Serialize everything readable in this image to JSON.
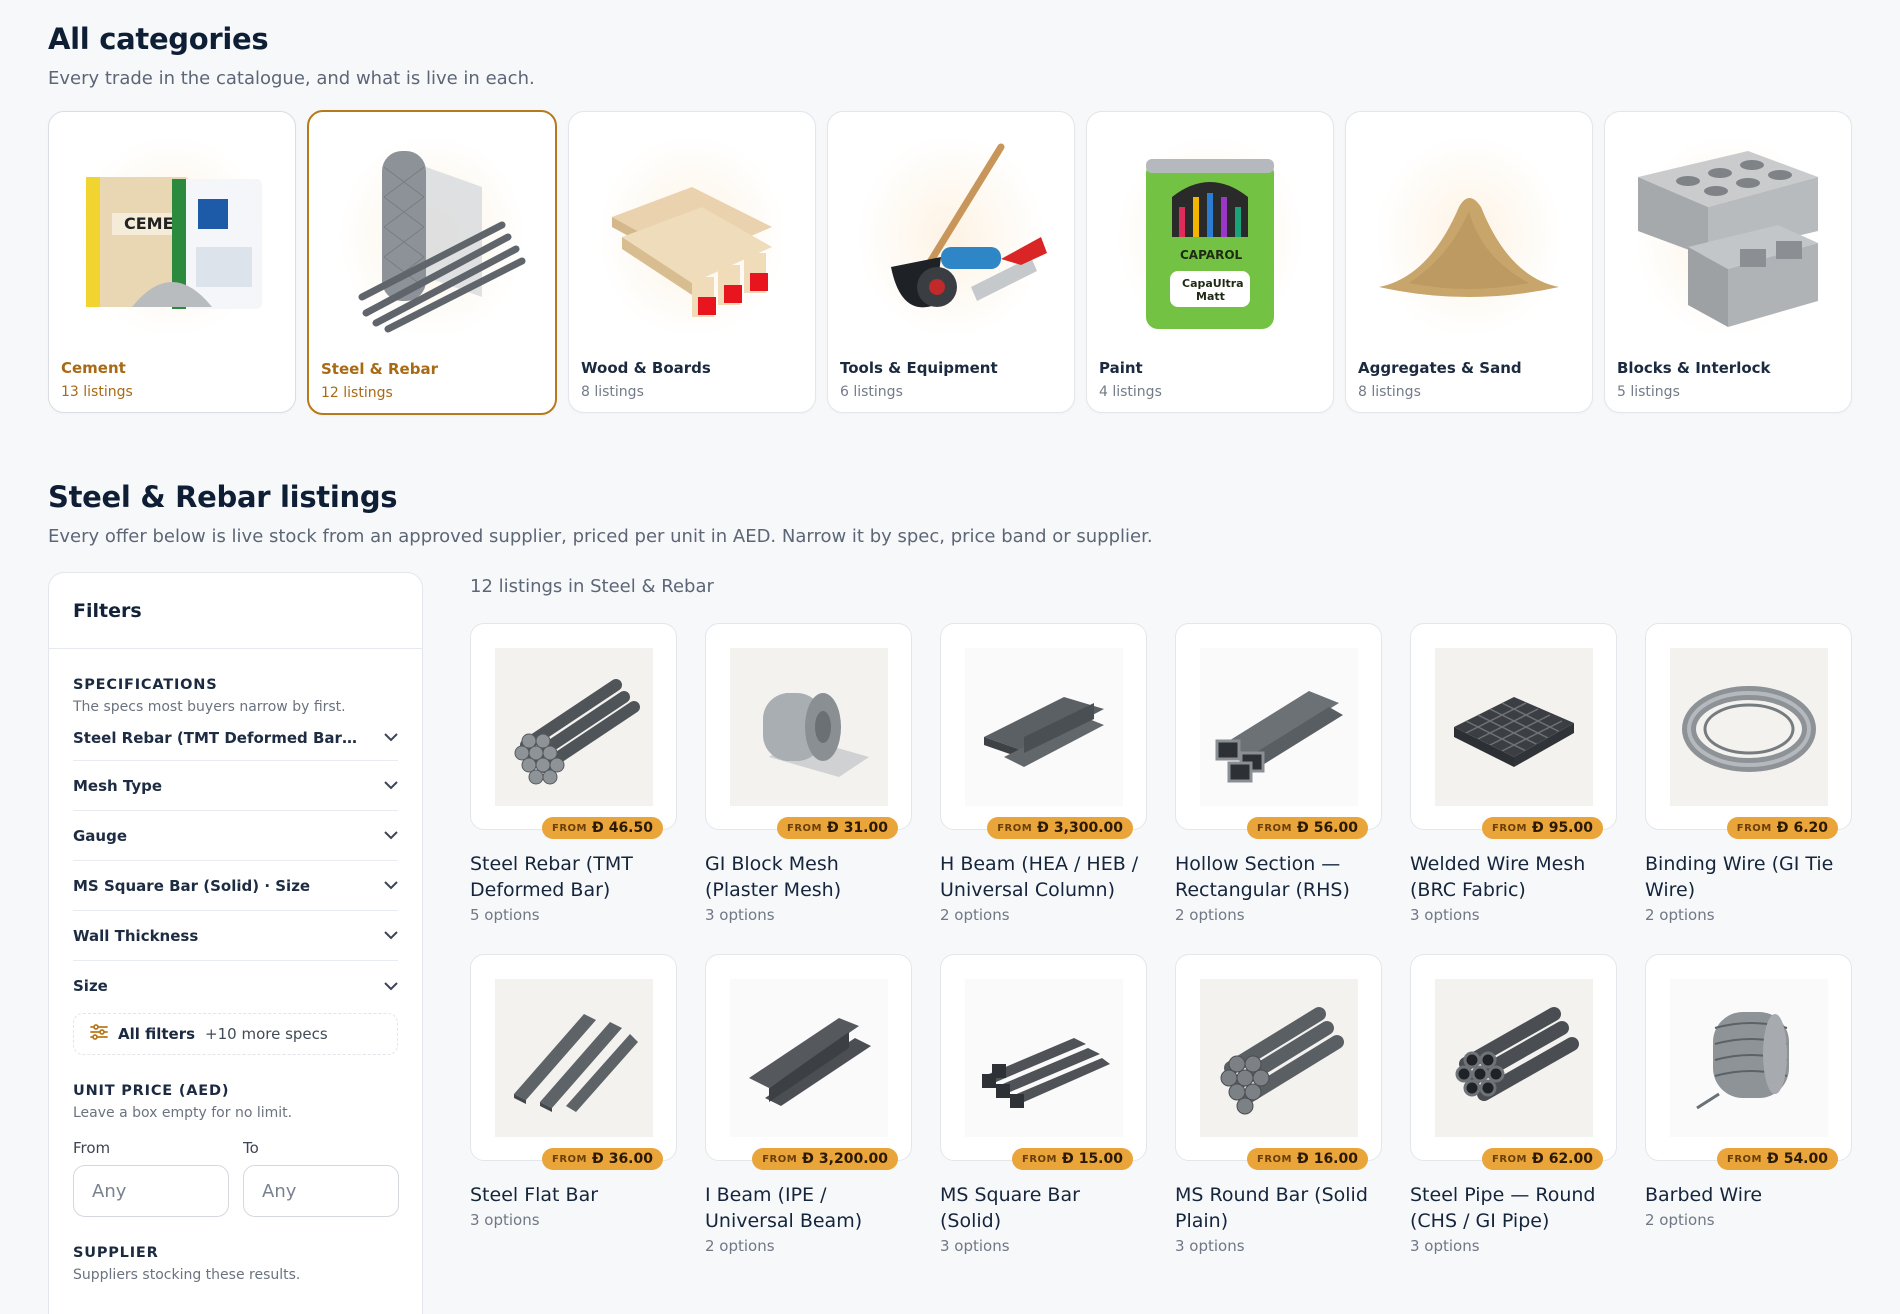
{
  "categories_section": {
    "title": "All categories",
    "subtitle": "Every trade in the catalogue, and what is live in each.",
    "items": [
      {
        "name": "Cement",
        "count": "13 listings",
        "icon": "cement-bag-icon"
      },
      {
        "name": "Steel & Rebar",
        "count": "12 listings",
        "icon": "rebar-icon",
        "selected": true
      },
      {
        "name": "Wood & Boards",
        "count": "8 listings",
        "icon": "wood-boards-icon"
      },
      {
        "name": "Tools & Equipment",
        "count": "6 listings",
        "icon": "tools-icon"
      },
      {
        "name": "Paint",
        "count": "4 listings",
        "icon": "paint-can-icon"
      },
      {
        "name": "Aggregates & Sand",
        "count": "8 listings",
        "icon": "sand-pile-icon"
      },
      {
        "name": "Blocks & Interlock",
        "count": "5 listings",
        "icon": "concrete-block-icon"
      }
    ]
  },
  "listings_section": {
    "title": "Steel & Rebar listings",
    "subtitle": "Every offer below is live stock from an approved supplier, priced per unit in AED. Narrow it by spec, price band or supplier.",
    "count_label": "12 listings in Steel & Rebar"
  },
  "filters": {
    "title": "Filters",
    "specs_label": "SPECIFICATIONS",
    "specs_hint": "The specs most buyers narrow by first.",
    "specs": [
      "Steel Rebar (TMT Deformed Bar) · Diameter",
      "Mesh Type",
      "Gauge",
      "MS Square Bar (Solid) · Size",
      "Wall Thickness",
      "Size"
    ],
    "all_filters_label": "All filters",
    "all_filters_more": "+10 more specs",
    "price_label": "UNIT PRICE (AED)",
    "price_hint": "Leave a box empty for no limit.",
    "from_label": "From",
    "to_label": "To",
    "from_placeholder": "Any",
    "to_placeholder": "Any",
    "supplier_label": "SUPPLIER",
    "supplier_hint": "Suppliers stocking these results."
  },
  "currency_symbol": "Ð",
  "from_label": "FROM",
  "products": [
    {
      "name": "Steel Rebar (TMT Deformed Bar)",
      "price": "46.50",
      "options": "5 options",
      "icon": "rebar-bundle-icon"
    },
    {
      "name": "GI Block Mesh (Plaster Mesh)",
      "price": "31.00",
      "options": "3 options",
      "icon": "mesh-roll-icon"
    },
    {
      "name": "H Beam (HEA / HEB / Universal Column)",
      "price": "3,300.00",
      "options": "2 options",
      "icon": "h-beam-icon"
    },
    {
      "name": "Hollow Section — Rectangular (RHS)",
      "price": "56.00",
      "options": "2 options",
      "icon": "hollow-section-icon"
    },
    {
      "name": "Welded Wire Mesh (BRC Fabric)",
      "price": "95.00",
      "options": "3 options",
      "icon": "wire-mesh-icon"
    },
    {
      "name": "Binding Wire (GI Tie Wire)",
      "price": "6.20",
      "options": "2 options",
      "icon": "wire-coil-icon"
    },
    {
      "name": "Steel Flat Bar",
      "price": "36.00",
      "options": "3 options",
      "icon": "flat-bar-icon"
    },
    {
      "name": "I Beam (IPE / Universal Beam)",
      "price": "3,200.00",
      "options": "2 options",
      "icon": "i-beam-icon"
    },
    {
      "name": "MS Square Bar (Solid)",
      "price": "15.00",
      "options": "3 options",
      "icon": "square-bar-icon"
    },
    {
      "name": "MS Round Bar (Solid Plain)",
      "price": "16.00",
      "options": "3 options",
      "icon": "round-bar-icon"
    },
    {
      "name": "Steel Pipe — Round (CHS / GI Pipe)",
      "price": "62.00",
      "options": "3 options",
      "icon": "steel-pipe-icon"
    },
    {
      "name": "Barbed Wire",
      "price": "54.00",
      "options": "2 options",
      "icon": "barbed-wire-icon"
    }
  ],
  "colors": {
    "accent": "#b8791d",
    "badge": "#e9a43a",
    "heading": "#0e1e35"
  }
}
